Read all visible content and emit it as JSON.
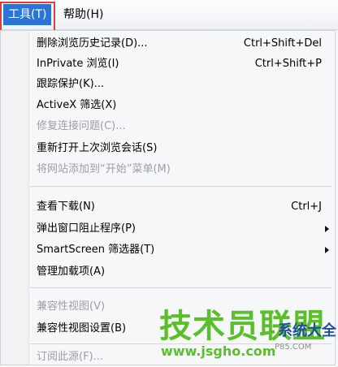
{
  "menubar": {
    "items": [
      {
        "label": "工具(T)"
      },
      {
        "label": "帮助(H)"
      }
    ]
  },
  "menu": {
    "items": [
      {
        "label": "删除浏览历史记录(D)...",
        "shortcut": "Ctrl+Shift+Del"
      },
      {
        "label": "InPrivate 浏览(I)",
        "shortcut": "Ctrl+Shift+P"
      },
      {
        "label": "跟踪保护(K)..."
      },
      {
        "label": "ActiveX 筛选(X)"
      },
      {
        "label": "修复连接问题(C)..."
      },
      {
        "label": "重新打开上次浏览会话(S)"
      },
      {
        "label": "将网站添加到“开始”菜单(M)"
      },
      {
        "label": "查看下载(N)",
        "shortcut": "Ctrl+J"
      },
      {
        "label": "弹出窗口阻止程序(P)"
      },
      {
        "label": "SmartScreen 筛选器(T)"
      },
      {
        "label": "管理加载项(A)"
      },
      {
        "label": "兼容性视图(V)"
      },
      {
        "label": "兼容性视图设置(B)"
      },
      {
        "label": "订阅此源(F)..."
      }
    ]
  },
  "watermark": {
    "main": "技术员联盟",
    "site": "www.jsgho.com",
    "side": "系统大全",
    "tiny": "P85.COM"
  }
}
